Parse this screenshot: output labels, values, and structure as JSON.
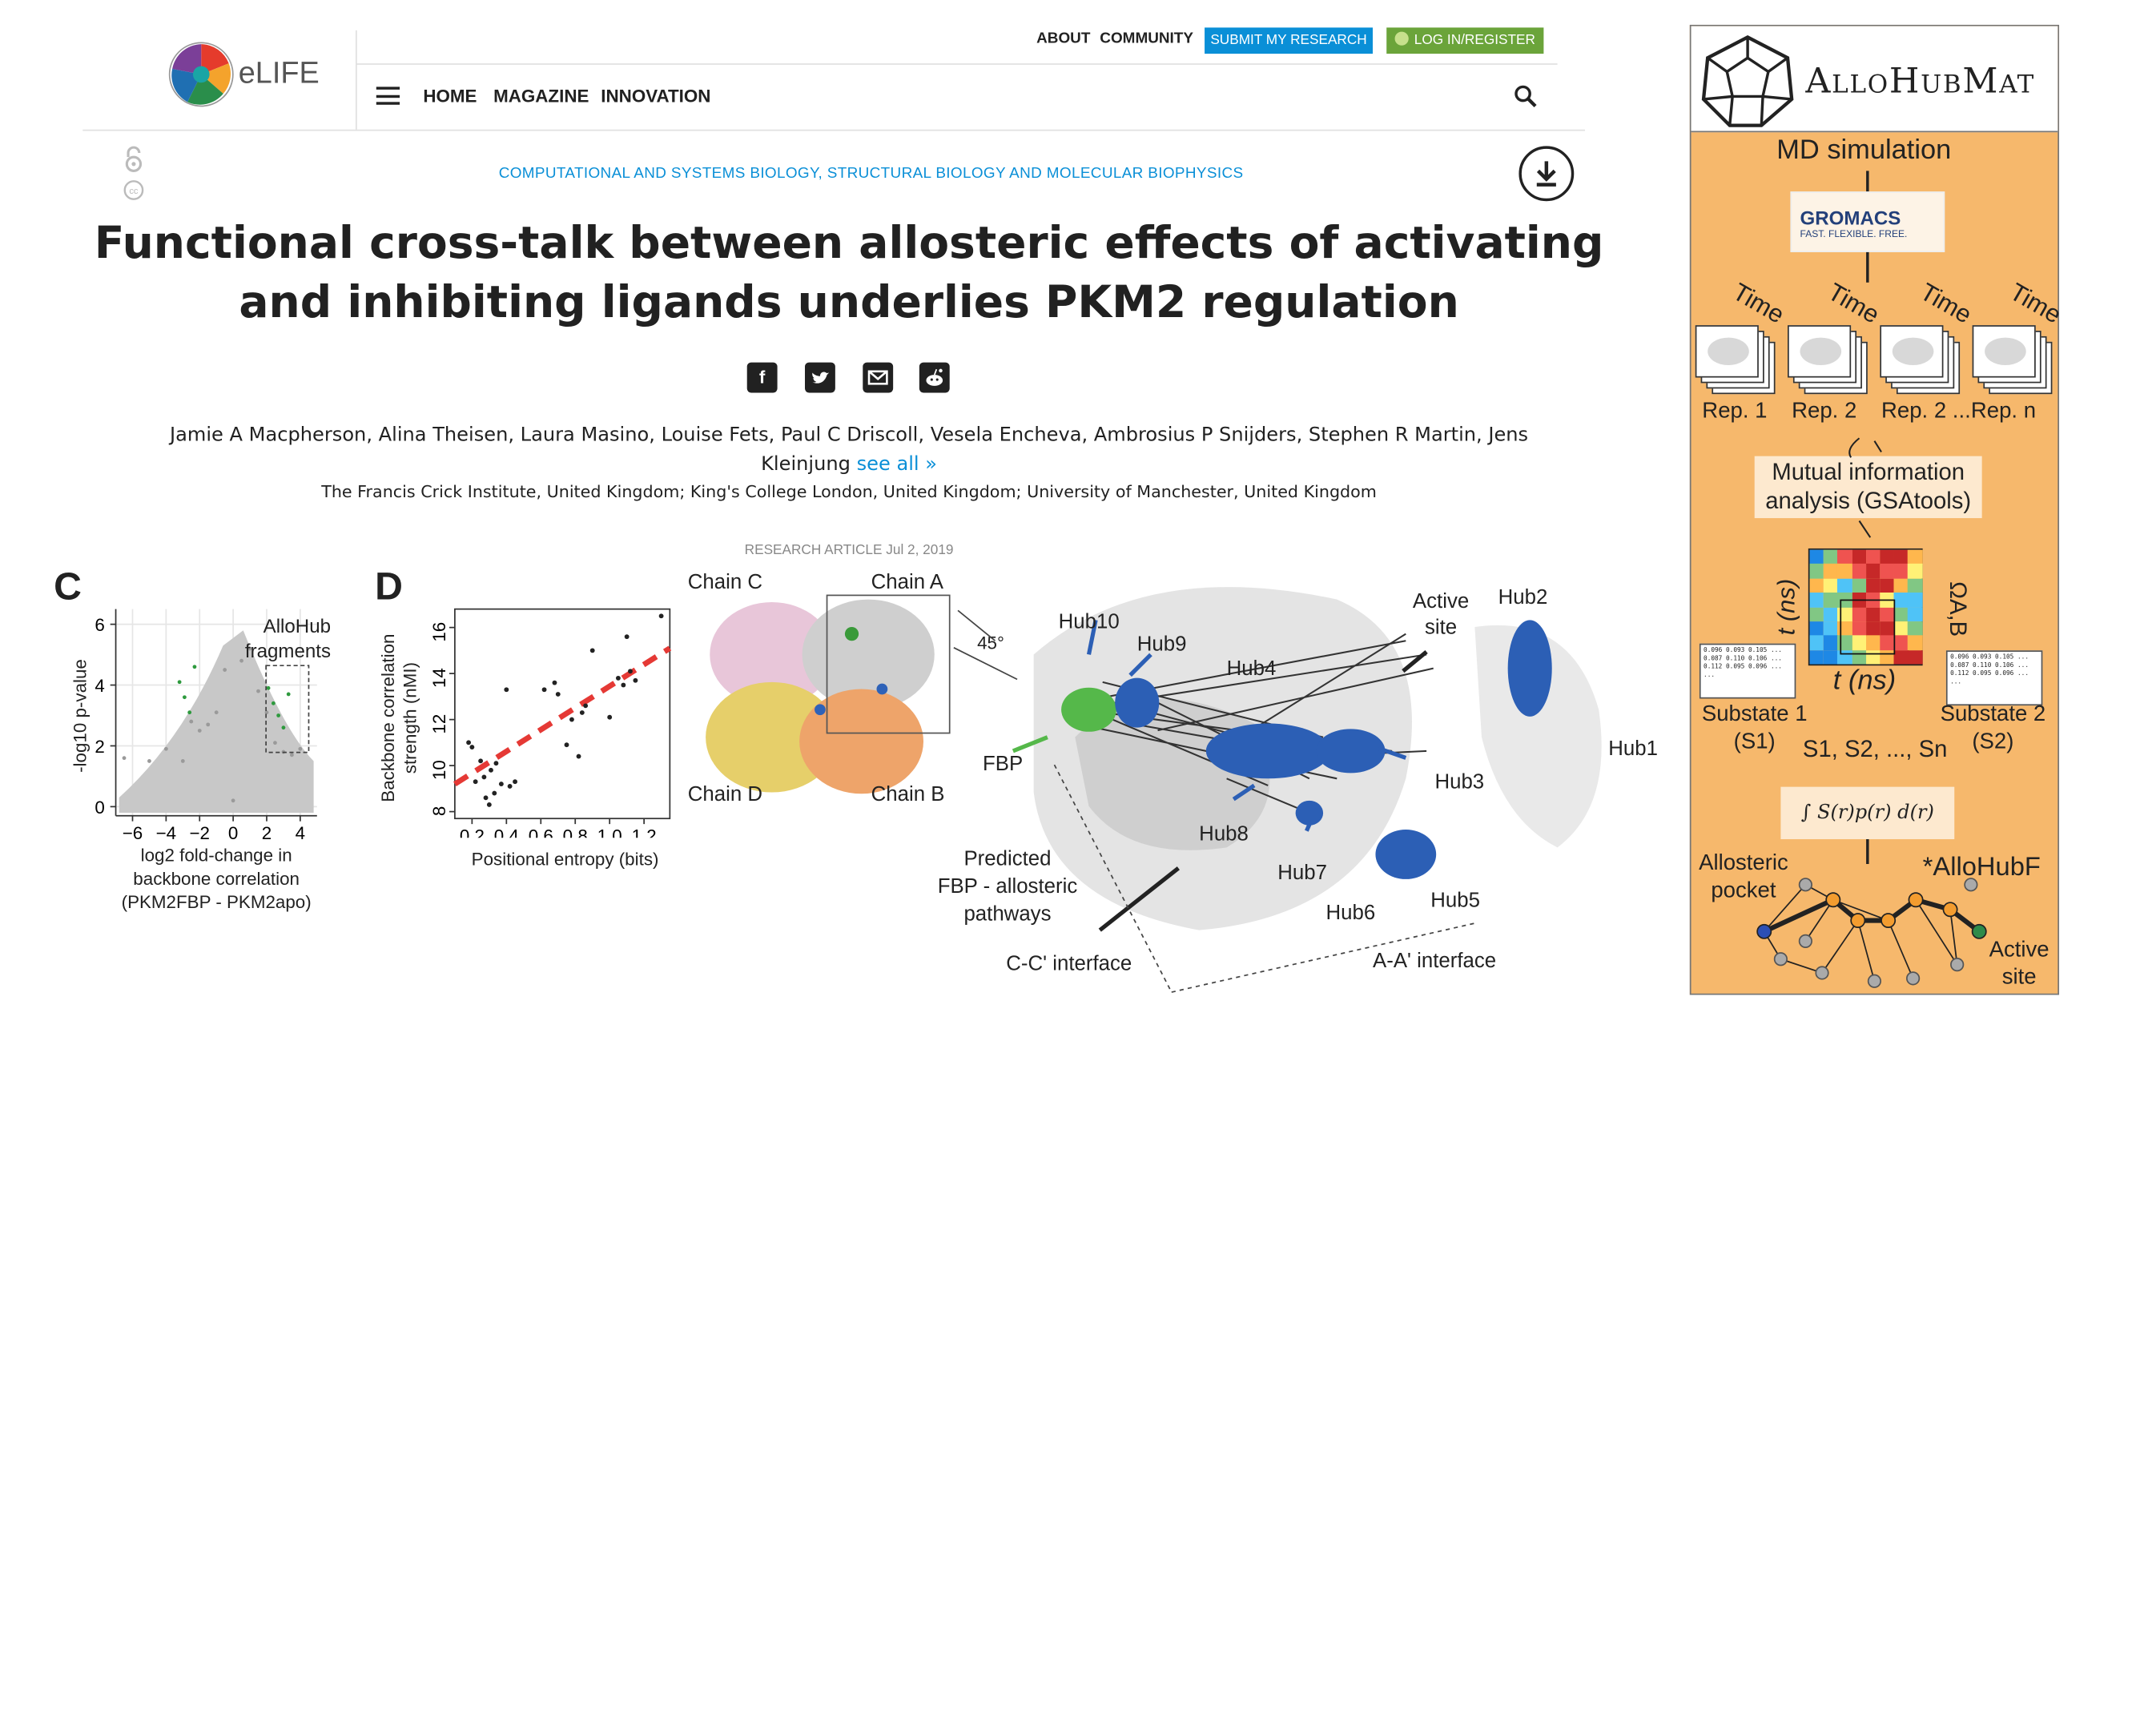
{
  "header": {
    "logo_text": "eLIFE",
    "top_links": [
      "ABOUT",
      "COMMUNITY"
    ],
    "submit_label": "SUBMIT MY RESEARCH",
    "login_label": "LOG IN/REGISTER",
    "nav": [
      "HOME",
      "MAGAZINE",
      "INNOVATION"
    ],
    "icons": [
      "menu-icon",
      "search-icon",
      "open-access-icon",
      "cc-icon",
      "download-icon"
    ]
  },
  "article": {
    "subjects": "COMPUTATIONAL AND SYSTEMS BIOLOGY, STRUCTURAL BIOLOGY AND MOLECULAR BIOPHYSICS",
    "title_line1": "Functional cross-talk between allosteric effects of activating",
    "title_line2": "and inhibiting ligands underlies PKM2 regulation",
    "share_icons": [
      "facebook-icon",
      "twitter-icon",
      "email-icon",
      "reddit-icon"
    ],
    "authors_line1": "Jamie A Macpherson, Alina Theisen, Laura Masino, Louise Fets, Paul C Driscoll, Vesela Encheva, Ambrosius P Snijders, Stephen R Martin, Jens",
    "authors_line2": "Kleinjung",
    "see_all": "see all »",
    "affiliations": "The Francis Crick Institute, United Kingdom; King's College London, United Kingdom; University of Manchester, United Kingdom",
    "meta": "RESEARCH ARTICLE Jul 2, 2019"
  },
  "figure": {
    "panel_c": {
      "letter": "C",
      "ylabel": "-log10 p-value",
      "xlabel_line1": "log2 fold-change in",
      "xlabel_line2": "backbone correlation",
      "xlabel_line3": "(PKM2FBP - PKM2apo)",
      "box_label_line1": "AlloHub",
      "box_label_line2": "fragments",
      "xticks": [
        "−6",
        "−4",
        "−2",
        "0",
        "2",
        "4"
      ],
      "yticks": [
        "0",
        "2",
        "4",
        "6"
      ]
    },
    "panel_d": {
      "letter": "D",
      "ylabel_line1": "Backbone correlation",
      "ylabel_line2": "strength (nMI)",
      "xlabel": "Positional entropy (bits)",
      "xticks": [
        "0.2",
        "0.4",
        "0.6",
        "0.8",
        "1.0",
        "1.2"
      ],
      "yticks": [
        "8",
        "10",
        "12",
        "14",
        "16"
      ]
    },
    "structure": {
      "chain_c": "Chain C",
      "chain_a": "Chain A",
      "chain_d": "Chain D",
      "chain_b": "Chain B",
      "rotation": "45°",
      "fbp": "FBP",
      "active_site_line1": "Active",
      "active_site_line2": "site",
      "predicted_line1": "Predicted",
      "predicted_line2": "FBP - allosteric",
      "predicted_line3": "pathways",
      "cc_interface": "C-C' interface",
      "aa_interface": "A-A' interface",
      "hubs": [
        "Hub10",
        "Hub9",
        "Hub4",
        "Hub2",
        "Hub1",
        "Hub3",
        "Hub8",
        "Hub7",
        "Hub6",
        "Hub5"
      ]
    }
  },
  "sidebar": {
    "brand": "AlloHubMat",
    "md_simulation": "MD simulation",
    "gromacs": "GROMACS",
    "gromacs_tag": "FAST. FLEXIBLE. FREE.",
    "time": "Time",
    "reps": [
      "Rep. 1",
      "Rep. 2",
      "Rep. 2 ...",
      "Rep. n"
    ],
    "mi_line1": "Mutual information",
    "mi_line2": "analysis (GSAtools)",
    "t_ns": "t (ns)",
    "omega": "ΩA,B",
    "substate1_line1": "Substate 1",
    "substate1_line2": "(S1)",
    "substate2_line1": "Substate 2",
    "substate2_line2": "(S2)",
    "substates_list": "S1, S2, ..., Sn",
    "integral": "∫ S(r)p(r)  d(r)",
    "allosteric_line1": "Allosteric",
    "allosteric_line2": "pocket",
    "allohubf": "*AlloHubF",
    "active_line1": "Active",
    "active_line2": "site",
    "matrix_text": "0.096 0.093 0.105 ...\n0.087 0.110 0.106 ...\n0.112 0.095 0.096 ...\n..."
  },
  "chart_data": [
    {
      "type": "scatter",
      "title": "",
      "xlabel": "log2 fold-change in backbone correlation (PKM2FBP - PKM2apo)",
      "ylabel": "-log10 p-value",
      "xlim": [
        -7,
        5
      ],
      "ylim": [
        -0.3,
        6.5
      ],
      "grid": true,
      "series": [
        {
          "name": "",
          "x": [
            -6.5,
            -5,
            -4,
            -3,
            -2.5,
            -2,
            -1.5,
            -1,
            -0.5,
            0,
            0.5,
            1,
            1.5,
            2,
            2.5,
            3,
            3.5,
            4
          ],
          "y": [
            1.6,
            1.5,
            1.9,
            1.5,
            2.8,
            2.5,
            2.7,
            3.1,
            4.5,
            0.2,
            4.8,
            5.2,
            3.8,
            3.1,
            2.1,
            1.8,
            1.7,
            1.9
          ]
        },
        {
          "name": "AlloHub fragments",
          "x": [
            -3.2,
            -2.9,
            -2.6,
            -2.3,
            2.1,
            2.4,
            2.7,
            3.0,
            3.3
          ],
          "y": [
            4.1,
            3.6,
            3.1,
            4.6,
            3.9,
            3.4,
            3.0,
            2.6,
            3.7
          ]
        }
      ]
    },
    {
      "type": "scatter",
      "title": "",
      "xlabel": "Positional entropy (bits)",
      "ylabel": "Backbone correlation strength (nMI)",
      "xlim": [
        0.1,
        1.35
      ],
      "ylim": [
        7.7,
        16.8
      ],
      "grid": false,
      "x": [
        0.18,
        0.2,
        0.22,
        0.25,
        0.27,
        0.28,
        0.3,
        0.31,
        0.33,
        0.34,
        0.37,
        0.4,
        0.42,
        0.45,
        0.62,
        0.68,
        0.7,
        0.75,
        0.78,
        0.82,
        0.84,
        0.86,
        0.9,
        1.0,
        1.05,
        1.08,
        1.1,
        1.12,
        1.15,
        1.3
      ],
      "y": [
        11.0,
        10.8,
        9.3,
        10.2,
        9.5,
        8.6,
        8.3,
        9.8,
        8.8,
        10.1,
        9.2,
        13.3,
        9.1,
        9.3,
        13.3,
        13.6,
        13.1,
        10.9,
        12.0,
        10.4,
        12.3,
        12.6,
        15.0,
        12.1,
        13.8,
        13.5,
        15.6,
        14.1,
        13.7,
        16.5
      ],
      "trendline": {
        "x": [
          0.1,
          1.35
        ],
        "y": [
          9.2,
          15.1
        ]
      }
    }
  ]
}
